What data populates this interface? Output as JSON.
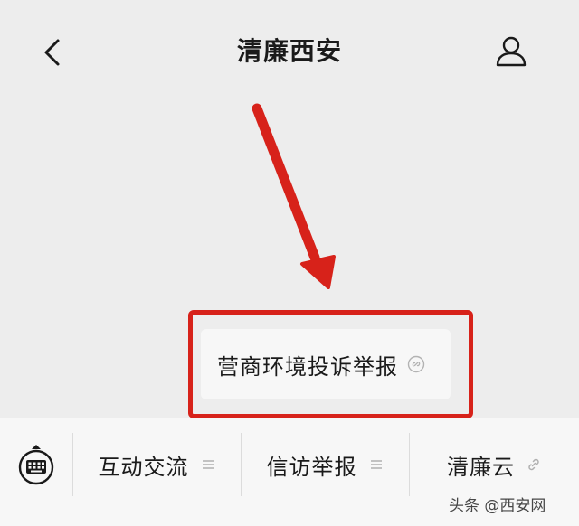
{
  "header": {
    "title": "清廉西安",
    "back_icon": "chevron-left-icon",
    "profile_icon": "person-icon"
  },
  "popup_menu": {
    "item_label": "营商环境投诉举报",
    "item_icon": "mini-program-link-icon"
  },
  "highlight": {
    "color": "#d7221a"
  },
  "bottom_menu": {
    "keyboard_icon": "keyboard-icon",
    "tabs": [
      {
        "label": "互动交流",
        "icon": "menu-lines-icon"
      },
      {
        "label": "信访举报",
        "icon": "menu-lines-icon"
      },
      {
        "label": "清廉云",
        "icon": "link-icon"
      }
    ]
  },
  "watermark": {
    "text": "头条 @西安网"
  },
  "colors": {
    "background": "#ededed",
    "bar_background": "#f7f7f7",
    "annotation_red": "#d7221a"
  }
}
